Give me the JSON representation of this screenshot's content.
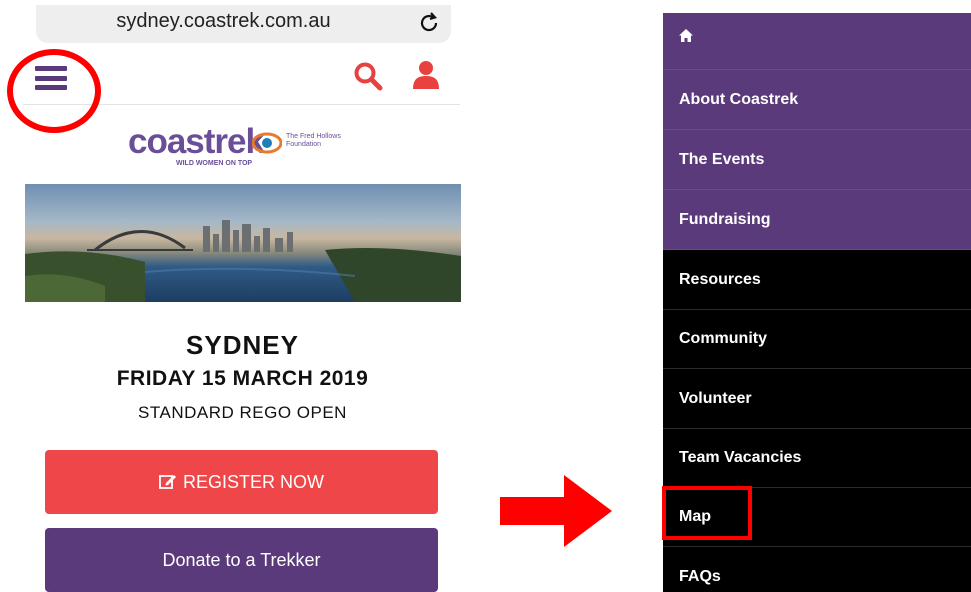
{
  "browser": {
    "url": "sydney.coastrek.com.au",
    "reload_icon": "reload-icon"
  },
  "header": {
    "menu_icon": "hamburger-icon",
    "search_icon": "search-icon",
    "account_icon": "user-icon"
  },
  "logo": {
    "brand": "coastrek",
    "tagline": "WILD WOMEN ON TOP",
    "partner_line1": "The Fred Hollows",
    "partner_line2": "Foundation"
  },
  "event": {
    "city": "SYDNEY",
    "date": "FRIDAY 15 MARCH 2019",
    "status": "STANDARD REGO OPEN"
  },
  "buttons": {
    "register": "REGISTER NOW",
    "donate": "Donate to a Trekker"
  },
  "menu": {
    "home_icon": "home-icon",
    "items": [
      {
        "label": "About Coastrek"
      },
      {
        "label": "The Events"
      },
      {
        "label": "Fundraising"
      },
      {
        "label": "Resources"
      },
      {
        "label": "Community"
      },
      {
        "label": "Volunteer"
      },
      {
        "label": "Team Vacancies"
      },
      {
        "label": "Map"
      },
      {
        "label": "FAQs"
      }
    ]
  },
  "colors": {
    "brand_purple": "#5b3a7c",
    "register_red": "#ef4749",
    "highlight_red": "#ff0000",
    "menu_black": "#000000"
  }
}
